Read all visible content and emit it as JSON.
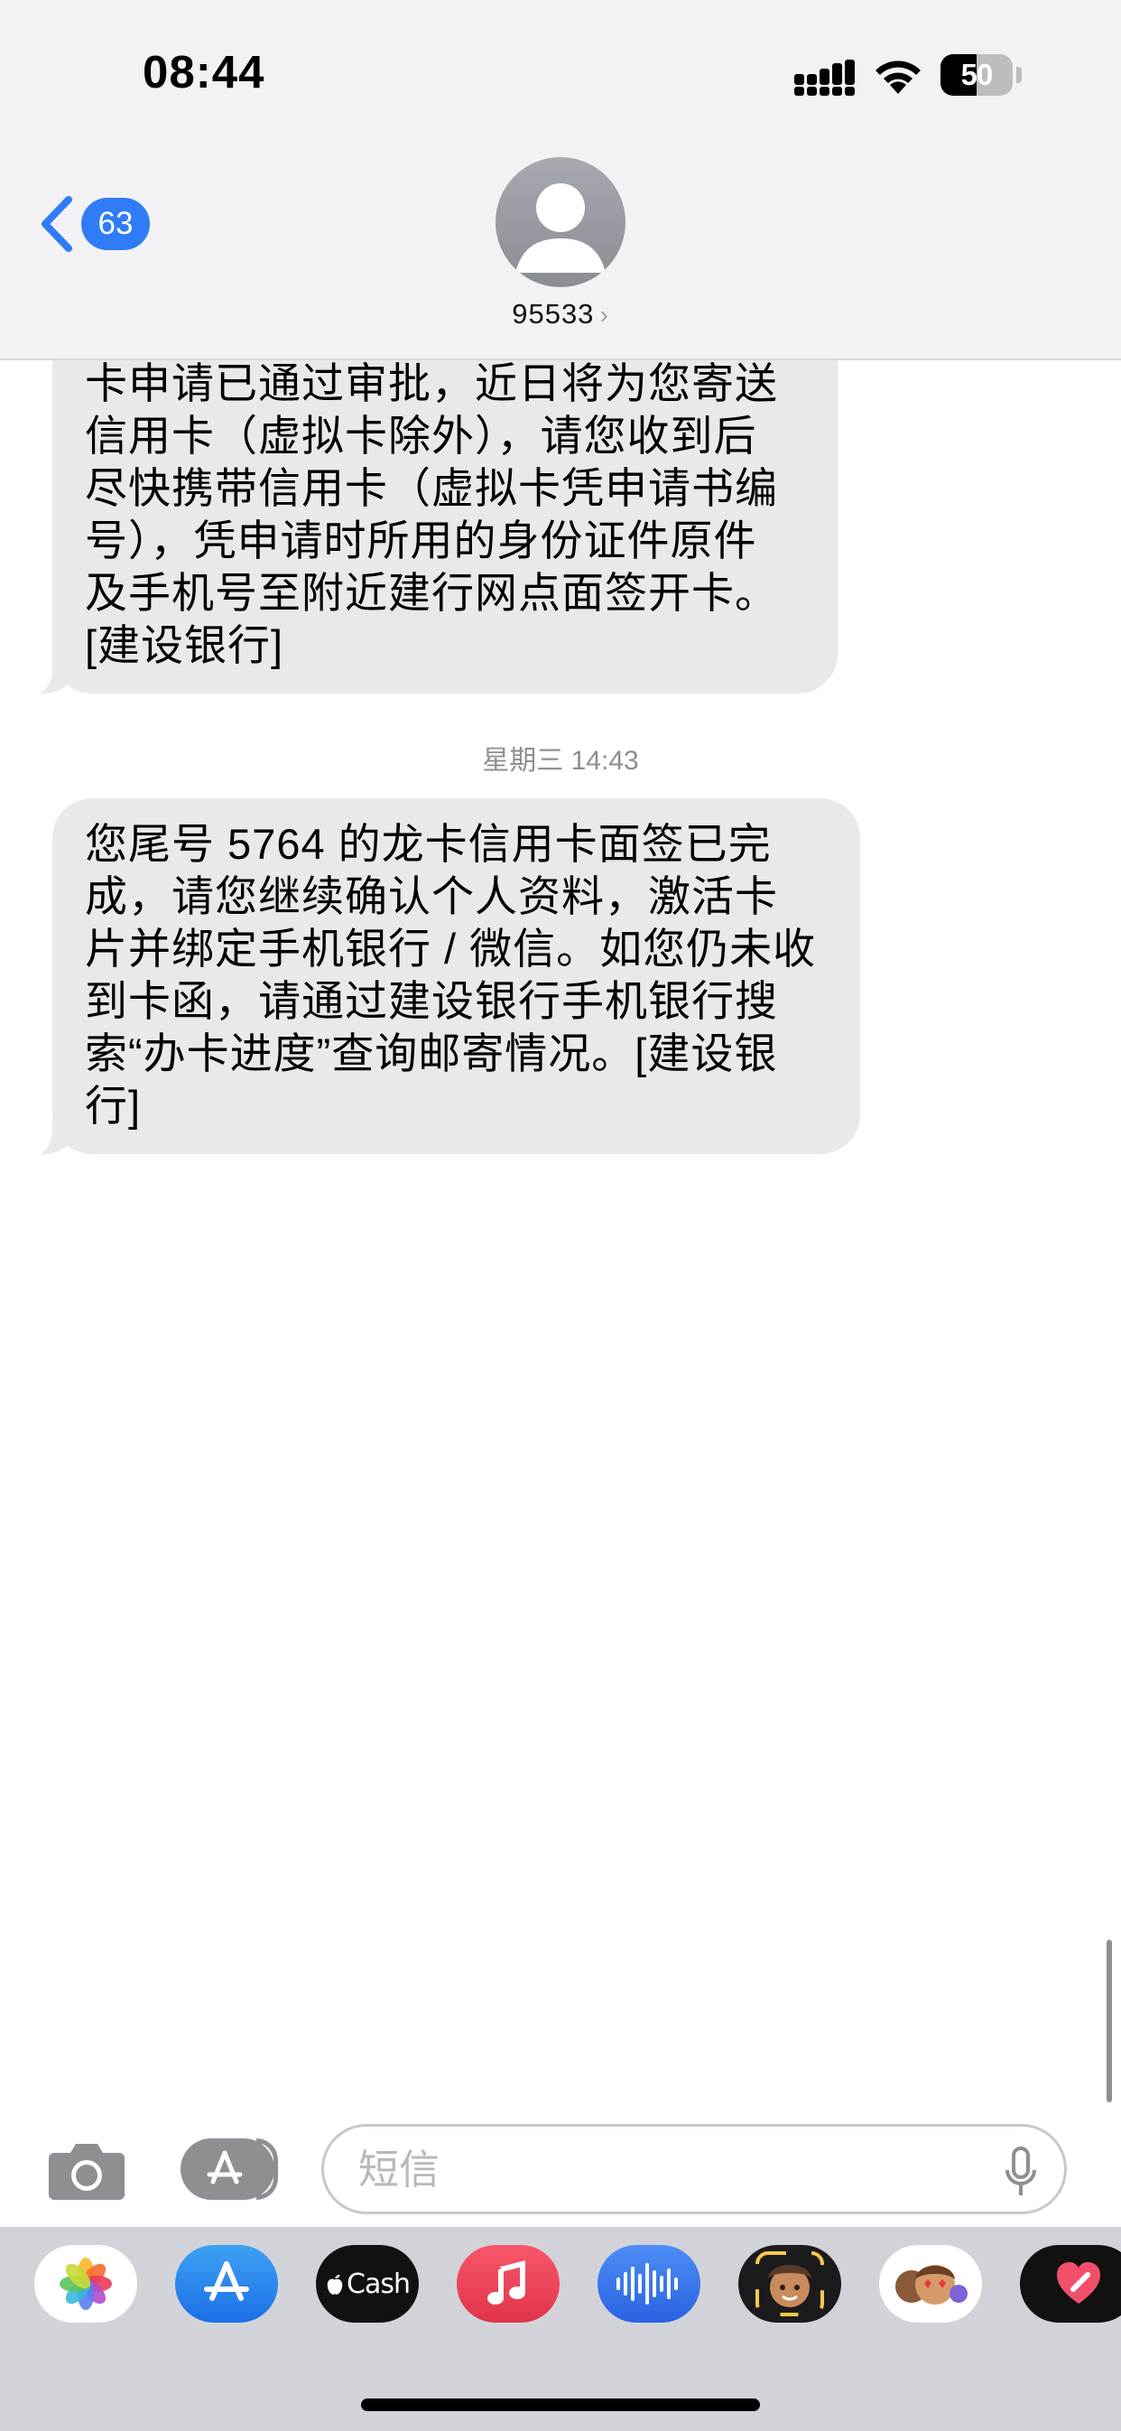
{
  "status_bar": {
    "time": "08:44",
    "battery": "50",
    "battery_level": 0.5
  },
  "header": {
    "back_count": "63",
    "contact": "95533",
    "contact_chevron": "›"
  },
  "messages": [
    {
      "text": "卡申请已通过审批，近日将为您寄送\n信用卡（虚拟卡除外），请您收到后\n尽快携带信用卡（虚拟卡凭申请书编\n号），凭申请时所用的身份证件原件\n及手机号至附近建行网点面签开卡。\n[建设银行]"
    },
    {
      "text": "您尾号 5764 的龙卡信用卡面签已完\n成，请您继续确认个人资料，激活卡\n片并绑定手机银行 / 微信。如您仍未收\n到卡函，请通过建设银行手机银行搜\n索“办卡进度”查询邮寄情况。[建设银\n行]"
    }
  ],
  "timestamp": "星期三 14:43",
  "composer": {
    "placeholder": "短信",
    "value": ""
  },
  "apps": [
    {
      "name": "photos-icon"
    },
    {
      "name": "app-store-icon"
    },
    {
      "name": "apple-cash-icon",
      "label": "Cash"
    },
    {
      "name": "music-icon"
    },
    {
      "name": "audio-message-icon"
    },
    {
      "name": "memoji-icon"
    },
    {
      "name": "memoji-stickers-icon"
    },
    {
      "name": "digital-touch-icon"
    }
  ],
  "colors": {
    "accent": "#2f7cf6",
    "bubble": "#e9e9eb",
    "tray": "#d2d3d9"
  }
}
